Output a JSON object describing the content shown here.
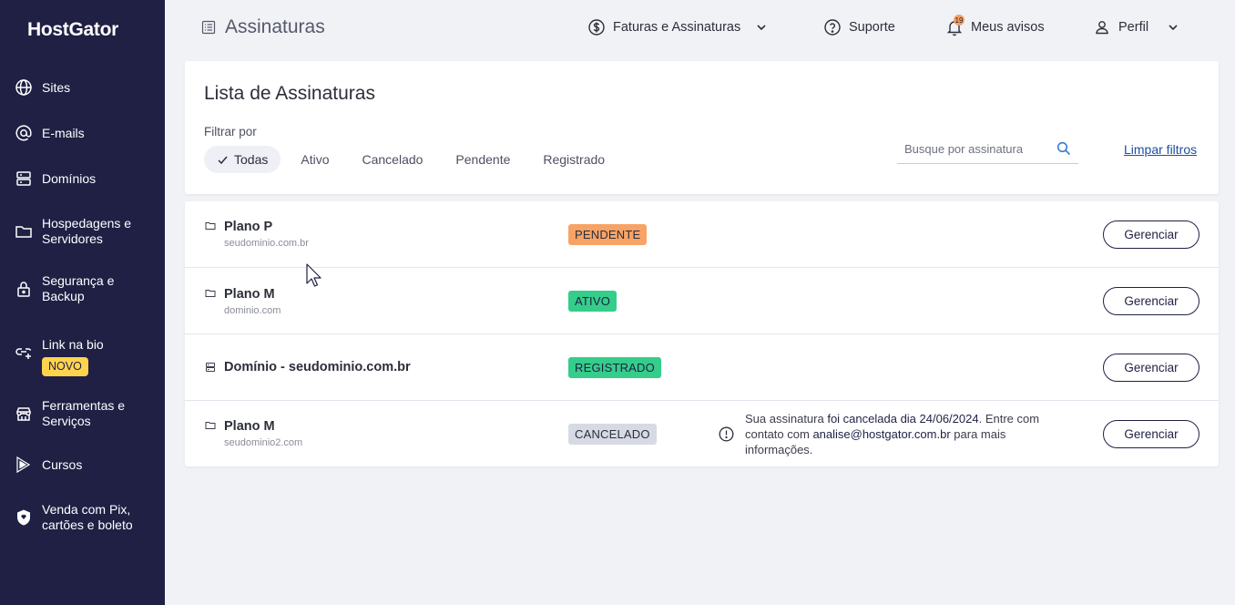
{
  "app": {
    "logo": "HostGator"
  },
  "sidebar": {
    "items": [
      {
        "label": "Sites",
        "icon": "globe-icon"
      },
      {
        "label": "E-mails",
        "icon": "at-icon"
      },
      {
        "label": "Domínios",
        "icon": "server-icon"
      },
      {
        "label_line1": "Hospedagens e",
        "label_line2": "Servidores",
        "icon": "folder-icon"
      },
      {
        "label_line1": "Segurança e",
        "label_line2": "Backup",
        "icon": "lock-icon"
      },
      {
        "label": "Link na bio",
        "badge": "NOVO",
        "icon": "link-icon"
      },
      {
        "label_line1": "Ferramentas e",
        "label_line2": "Serviços",
        "icon": "store-icon"
      },
      {
        "label": "Cursos",
        "icon": "play-icon"
      },
      {
        "label_line1": "Venda com Pix,",
        "label_line2": "cartões e boleto",
        "icon": "shield-icon"
      }
    ]
  },
  "header": {
    "title": "Assinaturas",
    "billing": "Faturas e Assinaturas",
    "support": "Suporte",
    "notifications": "Meus avisos",
    "notifications_count": "19",
    "profile": "Perfil"
  },
  "filters": {
    "title": "Lista de Assinaturas",
    "filter_label": "Filtrar por",
    "chips": [
      "Todas",
      "Ativo",
      "Cancelado",
      "Pendente",
      "Registrado"
    ],
    "active_chip": "Todas",
    "search_placeholder": "Busque por assinatura",
    "clear_label": "Limpar filtros"
  },
  "subscriptions": [
    {
      "title": "Plano P",
      "domain": "seudominio.com.br",
      "status": "PENDENTE",
      "action": "Gerenciar",
      "icon": "folder-icon"
    },
    {
      "title": "Plano M",
      "domain": "dominio.com",
      "status": "ATIVO",
      "action": "Gerenciar",
      "icon": "folder-icon"
    },
    {
      "title": "Domínio - seudominio.com.br",
      "domain": "",
      "status": "REGISTRADO",
      "action": "Gerenciar",
      "icon": "server-icon"
    },
    {
      "title": "Plano M",
      "domain": "seudominio2.com",
      "status": "CANCELADO",
      "action": "Gerenciar",
      "icon": "folder-icon",
      "notice": {
        "part1": "Sua assinatura ",
        "bold1": "foi cancelada dia 24/06/2024",
        "part2": ". Entre com contato com ",
        "bold2": "analise@hostgator.com.br",
        "part3": " para mais informações."
      }
    }
  ],
  "colors": {
    "sidebar_bg": "#1f2044",
    "page_bg": "#f1f2f6",
    "pending": "#f7a366",
    "active": "#35cd8a",
    "cancelled": "#d6dae4",
    "link": "#1f4fa0",
    "badge_new": "#ffd34e"
  }
}
